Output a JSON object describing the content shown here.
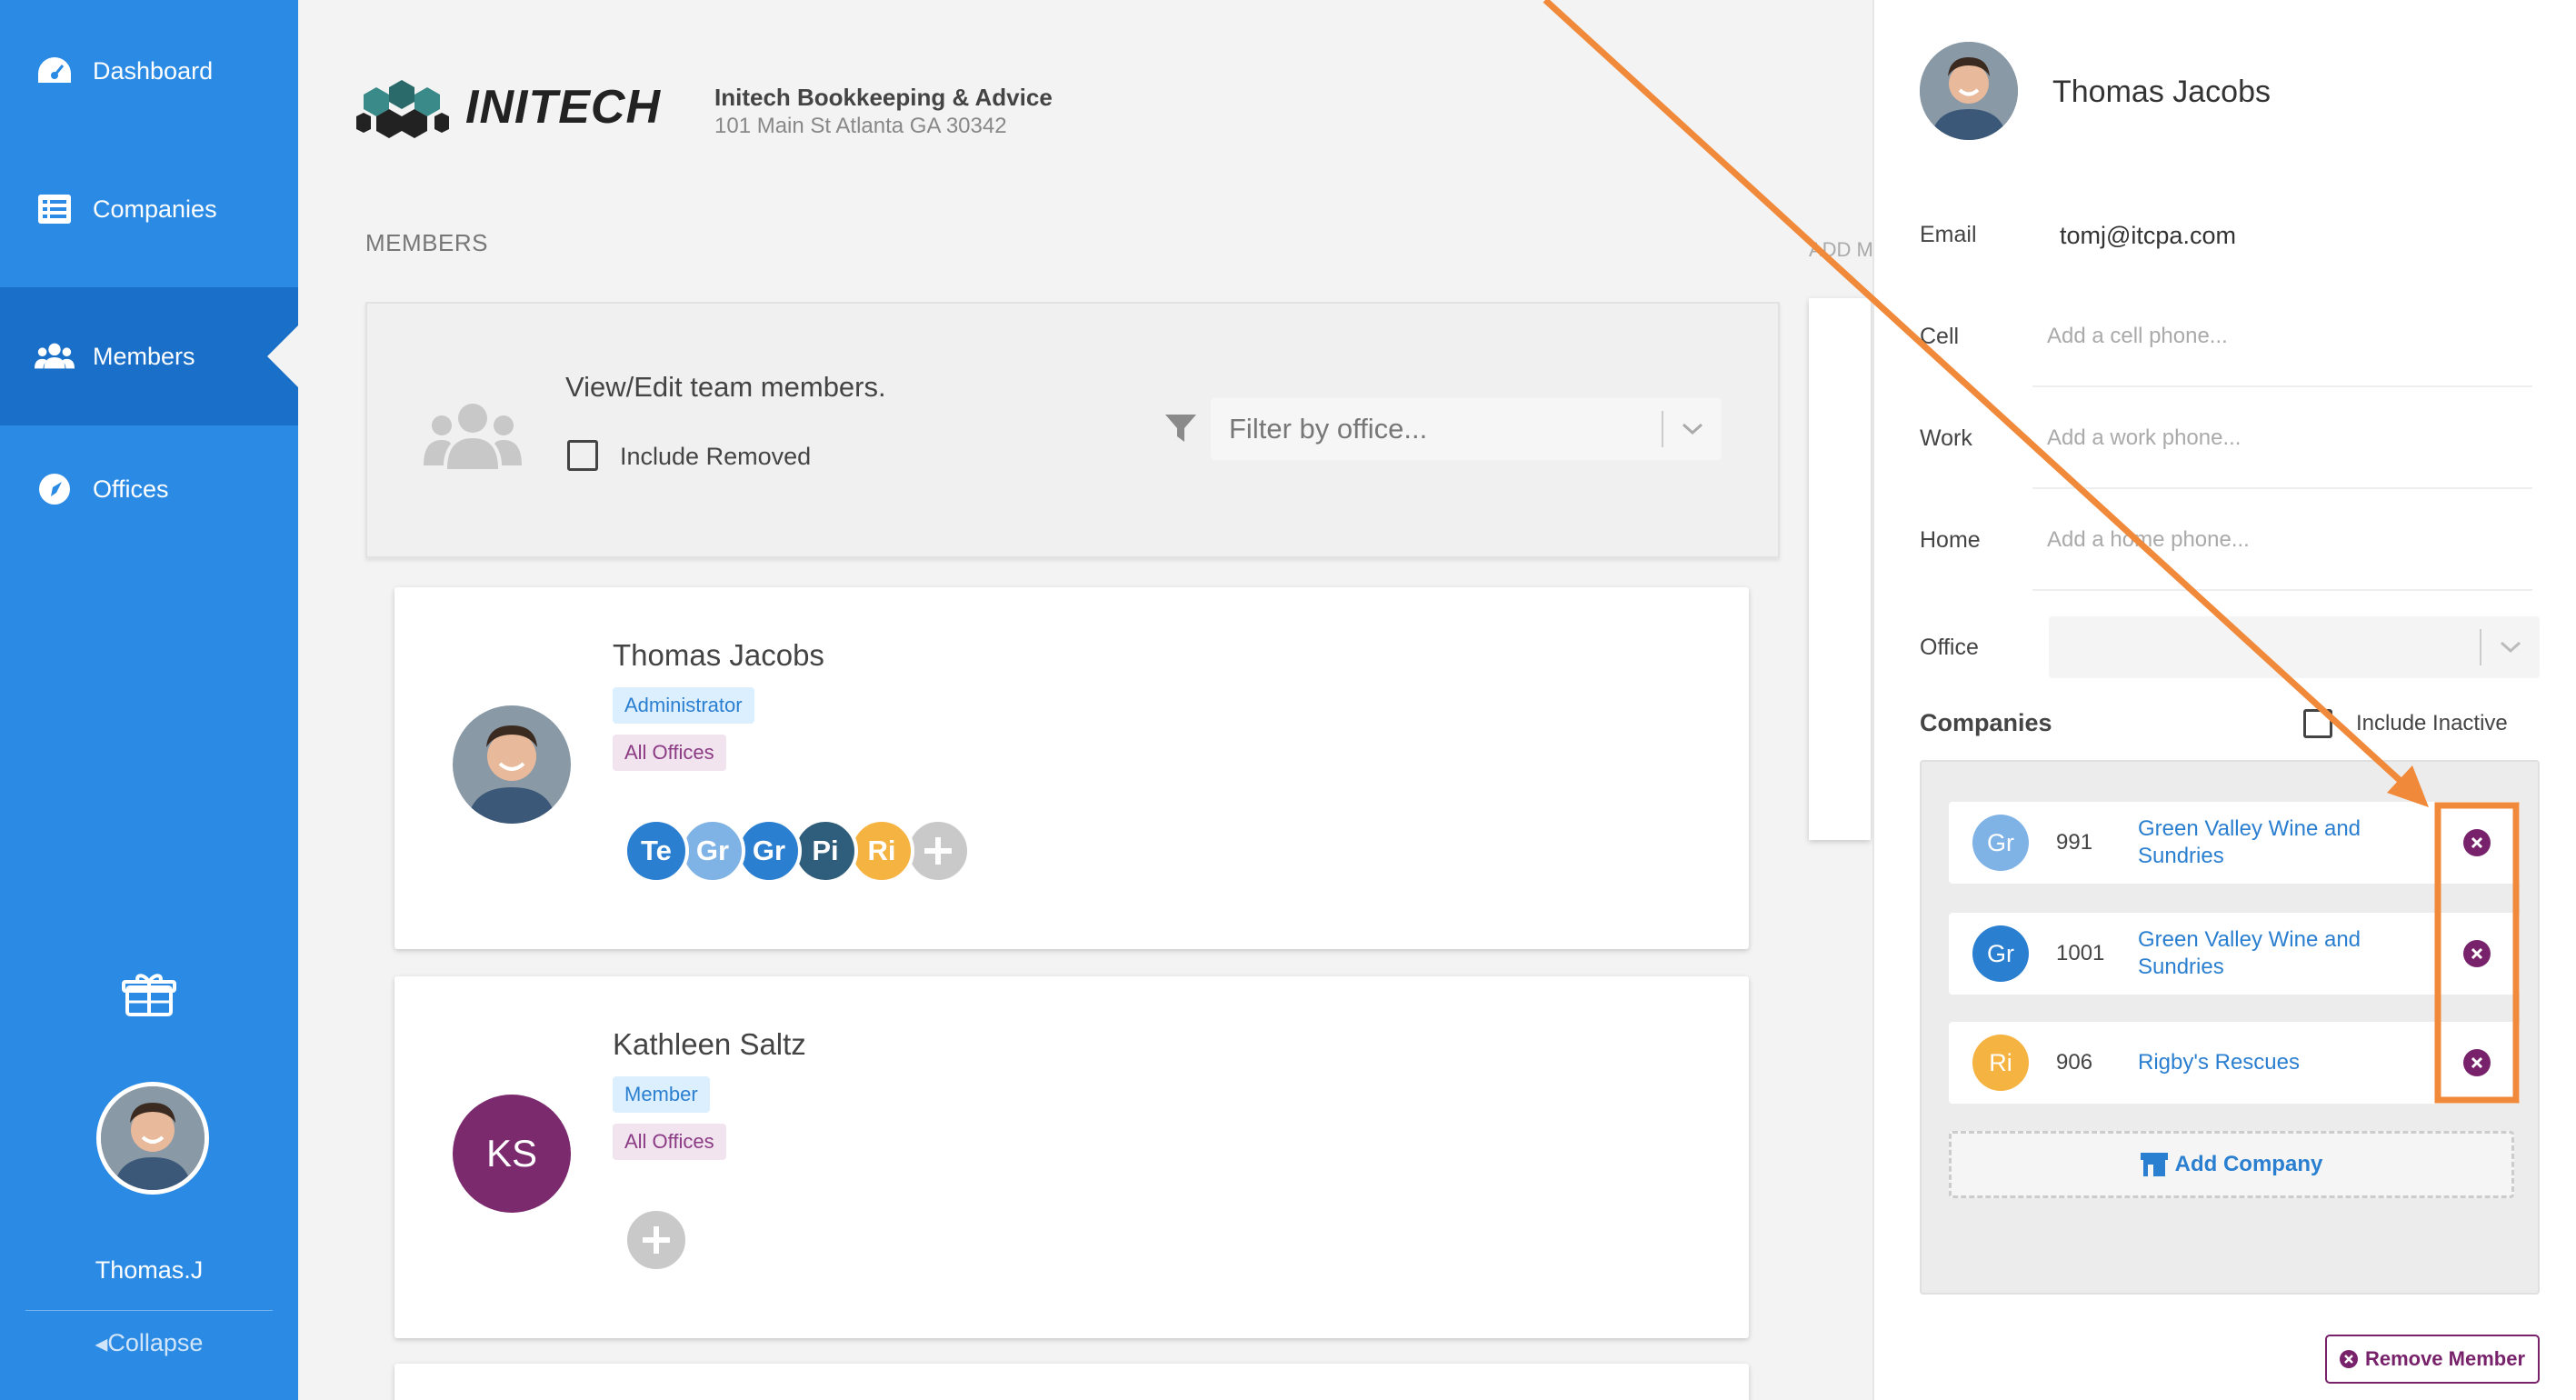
{
  "sidebar": {
    "items": [
      {
        "label": "Dashboard",
        "icon": "dashboard-icon"
      },
      {
        "label": "Companies",
        "icon": "list-icon"
      },
      {
        "label": "Members",
        "icon": "users-icon",
        "active": true
      },
      {
        "label": "Offices",
        "icon": "compass-icon"
      }
    ],
    "user_name": "Thomas.J",
    "collapse_label": "Collapse"
  },
  "header": {
    "logo_text": "INITECH",
    "org_name": "Initech Bookkeeping & Advice",
    "org_address": "101 Main St Atlanta GA 30342"
  },
  "main": {
    "section_title": "MEMBERS",
    "add_hint": "ADD M",
    "filter_card": {
      "title": "View/Edit team members.",
      "include_removed_label": "Include Removed",
      "filter_placeholder": "Filter by office..."
    },
    "members": [
      {
        "name": "Thomas Jacobs",
        "role": "Administrator",
        "offices": "All Offices",
        "companies": [
          {
            "abbr": "Te",
            "color": "#2b7fd0"
          },
          {
            "abbr": "Gr",
            "color": "#7fb3e6"
          },
          {
            "abbr": "Gr",
            "color": "#2b7fd0"
          },
          {
            "abbr": "Pi",
            "color": "#2f5d7c"
          },
          {
            "abbr": "Ri",
            "color": "#f5b342"
          }
        ]
      },
      {
        "name": "Kathleen Saltz",
        "initials": "KS",
        "avatar_color": "#7b2a6e",
        "role": "Member",
        "offices": "All Offices",
        "companies": []
      }
    ]
  },
  "panel": {
    "name": "Thomas Jacobs",
    "fields": {
      "email_label": "Email",
      "email_value": "tomj@itcpa.com",
      "cell_label": "Cell",
      "cell_placeholder": "Add a cell phone...",
      "work_label": "Work",
      "work_placeholder": "Add a work phone...",
      "home_label": "Home",
      "home_placeholder": "Add a home phone...",
      "office_label": "Office"
    },
    "companies_title": "Companies",
    "include_inactive_label": "Include Inactive",
    "companies": [
      {
        "abbr": "Gr",
        "number": "991",
        "name": "Green Valley Wine and Sundries",
        "color": "#7fb3e6"
      },
      {
        "abbr": "Gr",
        "number": "1001",
        "name": "Green Valley Wine and Sundries",
        "color": "#2b7fd0"
      },
      {
        "abbr": "Ri",
        "number": "906",
        "name": "Rigby's Rescues",
        "color": "#f5b342"
      }
    ],
    "add_company_label": "Add Company",
    "remove_member_label": "Remove Member"
  },
  "colors": {
    "sidebar": "#2a8ae4",
    "sidebar_active": "#1a6fc9",
    "accent": "#2b7fd0",
    "danger": "#77226a",
    "annotation": "#f0893a"
  }
}
